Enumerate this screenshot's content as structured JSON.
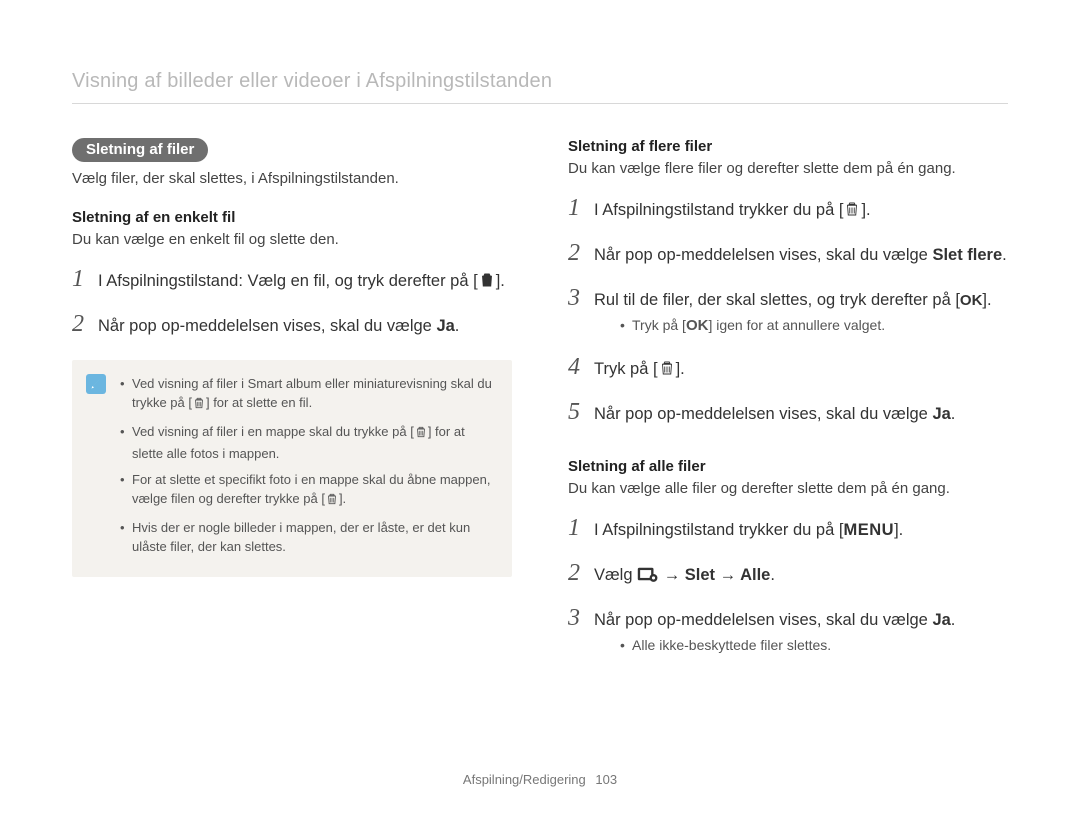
{
  "page_title": "Visning af billeder eller videoer i Afspilningstilstanden",
  "left": {
    "pill": "Sletning af filer",
    "intro": "Vælg filer, der skal slettes, i Afspilningstilstanden.",
    "sub1_h": "Sletning af en enkelt fil",
    "sub1_desc": "Du kan vælge en enkelt fil og slette den.",
    "step1_pre": "I Afspilningstilstand: Vælg en fil, og tryk derefter på [",
    "step1_post": "].",
    "step2_pre": "Når pop op-meddelelsen vises, skal du vælge ",
    "step2_bold": "Ja",
    "step2_post": ".",
    "note_li1_pre": "Ved visning af filer i Smart album eller miniaturevisning skal du trykke på [",
    "note_li1_post": "] for at slette en fil.",
    "note_li2_pre": "Ved visning af filer i en mappe skal du trykke på [",
    "note_li2_post": "] for at slette alle fotos i mappen.",
    "note_li3_pre": "For at slette et specifikt foto i en mappe skal du åbne mappen, vælge filen og derefter trykke på [",
    "note_li3_post": "].",
    "note_li4": "Hvis der er nogle billeder i mappen, der er låste, er det kun ulåste filer, der kan slettes."
  },
  "right": {
    "sub1_h": "Sletning af flere filer",
    "sub1_desc": "Du kan vælge flere filer og derefter slette dem på én gang.",
    "r_step1_pre": "I Afspilningstilstand trykker du på [",
    "r_step1_post": "].",
    "r_step2_pre": "Når pop op-meddelelsen vises, skal du vælge ",
    "r_step2_bold": "Slet flere",
    "r_step2_post": ".",
    "r_step3_pre": "Rul til de filer, der skal slettes, og tryk derefter på [",
    "r_step3_ok": "OK",
    "r_step3_post": "].",
    "r_step3_sub_pre": "Tryk på [",
    "r_step3_sub_ok": "OK",
    "r_step3_sub_post": "] igen for at annullere valget.",
    "r_step4_pre": "Tryk på [",
    "r_step4_post": "].",
    "r_step5_pre": "Når pop op-meddelelsen vises, skal du vælge ",
    "r_step5_bold": "Ja",
    "r_step5_post": ".",
    "sub2_h": "Sletning af alle filer",
    "sub2_desc": "Du kan vælge alle filer og derefter slette dem på én gang.",
    "r2_step1_pre": "I Afspilningstilstand trykker du på [",
    "r2_step1_menu": "MENU",
    "r2_step1_post": "].",
    "r2_step2_pre": "Vælg ",
    "r2_step2_bold": " → Slet → Alle",
    "r2_step2_post": ".",
    "r2_step3_pre": "Når pop op-meddelelsen vises, skal du vælge ",
    "r2_step3_bold": "Ja",
    "r2_step3_post": ".",
    "r2_sub": "Alle ikke-beskyttede filer slettes."
  },
  "footer_section": "Afspilning/Redigering",
  "footer_page": "103"
}
